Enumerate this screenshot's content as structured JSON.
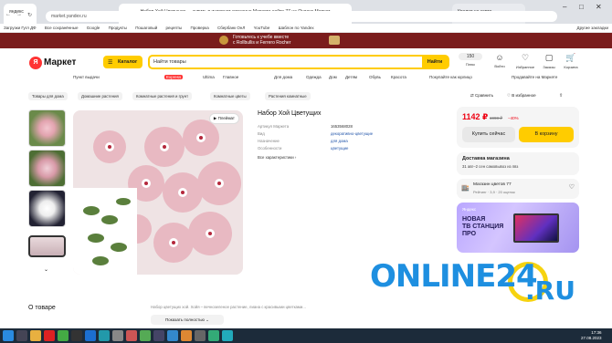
{
  "browser": {
    "tabs": [
      "яндекс",
      "Набор Хой | Цветущих · купить в интернет-магазине Маркета",
      "Кредит на карте"
    ],
    "url": "market.yandex.ru",
    "page_title": "Набор Хой Цветущих — купить в интернет-магазине Маркета сайте 77 на Яндекс Маркет"
  },
  "bookmarks": [
    "Загрузки Гугл ДФ",
    "Все сохранённые",
    "Google",
    "Продукты",
    "Пошаговый",
    "рецепты",
    "Проверка",
    "Сбербанк ОнЛ",
    "YouTube",
    "Шаблон по Yandex",
    "Другие закладки"
  ],
  "promo": {
    "line1": "Готовьтесь к учебе вместе",
    "line2": "с Rollbullis и Ferrero Rocher"
  },
  "header": {
    "logo_letter": "Я",
    "logo_text": "Маркет",
    "catalog": "Каталог",
    "search_placeholder": "Найти товары",
    "search_button": "Найти",
    "icons": [
      {
        "label": "Плюс",
        "badge": "150"
      },
      {
        "label": "Войти"
      },
      {
        "label": "Избранное"
      },
      {
        "label": "Заказы"
      },
      {
        "label": "Корзина"
      }
    ]
  },
  "subnav": [
    "Пункт выдачи",
    "Express",
    "Ultima",
    "Главное",
    "Для дома",
    "Одежда",
    "Дом",
    "Детям",
    "Обувь",
    "Красота",
    "Покупайте как юрлицо",
    "Продавайте на Маркете"
  ],
  "breadcrumbs": [
    "Товары для дома",
    "Домашние растения",
    "Комнатные растения и грунт",
    "Комнатные цветы",
    "Растения комнатные"
  ],
  "actions": {
    "compare": "Сравнить",
    "favorite": "В избранное"
  },
  "product": {
    "title": "Набор Хой Цветущих",
    "video_badge": "Плеймат",
    "specs": [
      {
        "k": "Артикул Маркета",
        "v": "1653568028"
      },
      {
        "k": "Вид",
        "v": "декоративно-цветущие"
      },
      {
        "k": "Назначение",
        "v": "для дома"
      },
      {
        "k": "Особенности",
        "v": "цветущие"
      }
    ],
    "all_specs": "Все характеристики"
  },
  "buy": {
    "price": "1142 ₽",
    "old_price": "1998 ₽",
    "discount": "−40%",
    "buy_now": "Купить сейчас",
    "to_cart": "В корзину"
  },
  "delivery": {
    "title": "Доставка магазина",
    "text": "31 авг–2 сен самовывоз из пвз"
  },
  "shop": {
    "name": "Магазин цветов 77",
    "rating": "Рейтинг · 3,9 · 20 оценок"
  },
  "ad": {
    "brand": "Яндекс",
    "line1": "НОВАЯ",
    "line2": "ТВ СТАНЦИЯ",
    "line3": "ПРО"
  },
  "about": {
    "title": "О товаре",
    "text": "Набор цветущих хой. Хойя – вечнозеленое растение, лиана с красивыми цветками...",
    "show_all": "Показать полностью"
  },
  "watermark": {
    "left": "ONLINE",
    "num": "24",
    "right": ".RU"
  },
  "taskbar": {
    "time": "17:36",
    "date": "27.08.2023"
  }
}
